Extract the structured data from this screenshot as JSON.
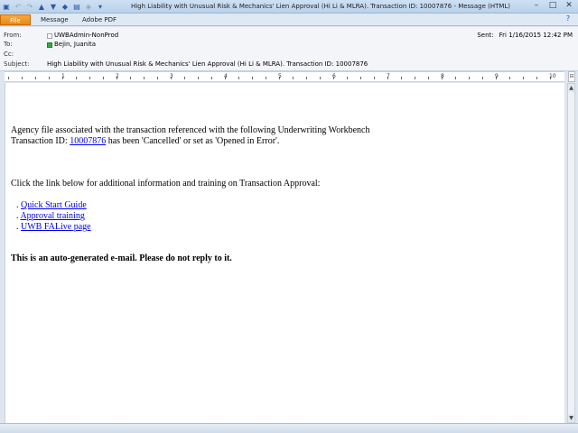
{
  "window": {
    "title": "High Liability with Unusual Risk & Mechanics' Lien Approval (Hi Li & MLRA). Transaction ID: 10007876  -  Message (HTML)",
    "quick_access_icons": [
      "save-icon",
      "undo-icon",
      "redo-icon",
      "previous-icon",
      "next-icon",
      "move-icon",
      "print-icon",
      "attach-icon",
      "customize-icon"
    ],
    "controls": {
      "minimize": "–",
      "maximize": "□",
      "close": "✕"
    }
  },
  "ribbon": {
    "tabs": [
      "File",
      "Message",
      "Adobe PDF"
    ],
    "help_icon": "?"
  },
  "header": {
    "from_label": "From:",
    "from_value": "UWBAdmin-NonProd",
    "to_label": "To:",
    "to_value": "Bejin, Juanita",
    "cc_label": "Cc:",
    "cc_value": "",
    "subject_label": "Subject:",
    "subject_value": "High Liability with Unusual Risk & Mechanics' Lien Approval (Hi Li & MLRA). Transaction ID: 10007876",
    "sent_label": "Sent:",
    "sent_value": "Fri 1/16/2015 12:42 PM"
  },
  "ruler": {
    "numbers": [
      "1",
      "2",
      "3",
      "4",
      "5",
      "6",
      "7",
      "8",
      "9",
      "10"
    ]
  },
  "message": {
    "para1_line1": "Agency file associated with the transaction referenced with the following Underwriting Workbench",
    "para1_line2_prefix": "Transaction ID: ",
    "transaction_link": "10007876",
    "para1_line2_suffix": " has been 'Cancelled' or set as 'Opened in Error'.",
    "para2": "Click the link below for additional information and training on Transaction Approval:",
    "bullet": ".",
    "links": [
      "Quick Start Guide",
      "Approval training",
      "UWB FALive page"
    ],
    "footer_note": "This is an auto-generated e-mail. Please do not reply to it."
  }
}
